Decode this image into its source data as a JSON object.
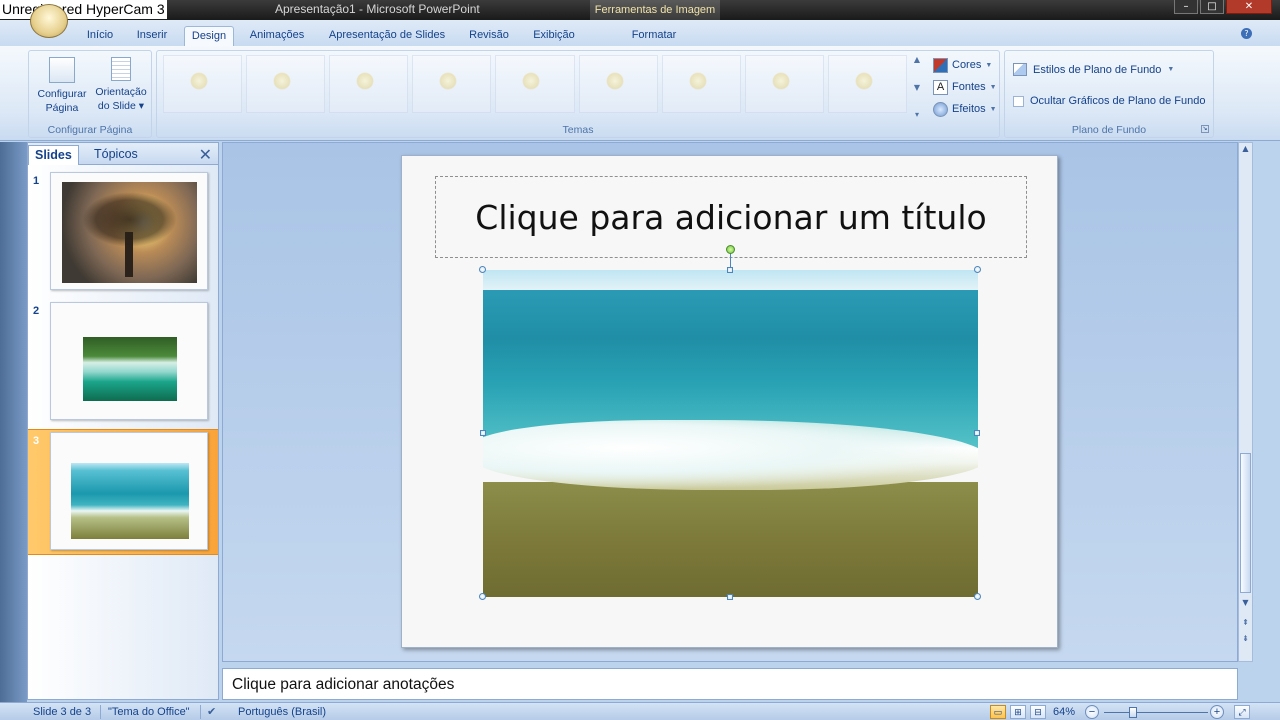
{
  "recorder": {
    "watermark": "Unregistered HyperCam 3"
  },
  "window": {
    "title": "Apresentação1 - Microsoft PowerPoint",
    "contextual_tab_group": "Ferramentas de Imagem",
    "buttons": {
      "minimize": "–",
      "maximize": "□",
      "close": "✕"
    }
  },
  "ribbon": {
    "tabs": [
      "Início",
      "Inserir",
      "Design",
      "Animações",
      "Apresentação de Slides",
      "Revisão",
      "Exibição",
      "Formatar"
    ],
    "active_tab": "Design",
    "groups": {
      "page_setup": {
        "label": "Configurar Página",
        "buttons": [
          {
            "line1": "Configurar",
            "line2": "Página"
          },
          {
            "line1": "Orientação",
            "line2": "do Slide ▾"
          }
        ]
      },
      "themes": {
        "label": "Temas",
        "options": {
          "colors": "Cores",
          "fonts": "Fontes",
          "effects": "Efeitos"
        }
      },
      "background": {
        "label": "Plano de Fundo",
        "styles": "Estilos de Plano de Fundo",
        "hide_graphics": "Ocultar Gráficos de Plano de Fundo",
        "hide_graphics_checked": false
      }
    }
  },
  "left_pane": {
    "tabs": [
      "Slides",
      "Tópicos"
    ],
    "active_tab": "Slides",
    "close": "✕",
    "slides": [
      {
        "number": "1",
        "image": "tree-sunset"
      },
      {
        "number": "2",
        "image": "waterfall"
      },
      {
        "number": "3",
        "image": "sea-beach",
        "selected": true
      }
    ]
  },
  "slide": {
    "title_placeholder": "Clique para adicionar um título",
    "image": "sea-beach-photo"
  },
  "notes": {
    "placeholder": "Clique para adicionar anotações"
  },
  "status_bar": {
    "slide_position": "Slide 3 de 3",
    "theme": "\"Tema do Office\"",
    "language": "Português (Brasil)",
    "zoom": "64%",
    "zoom_minus": "−",
    "zoom_plus": "+"
  }
}
